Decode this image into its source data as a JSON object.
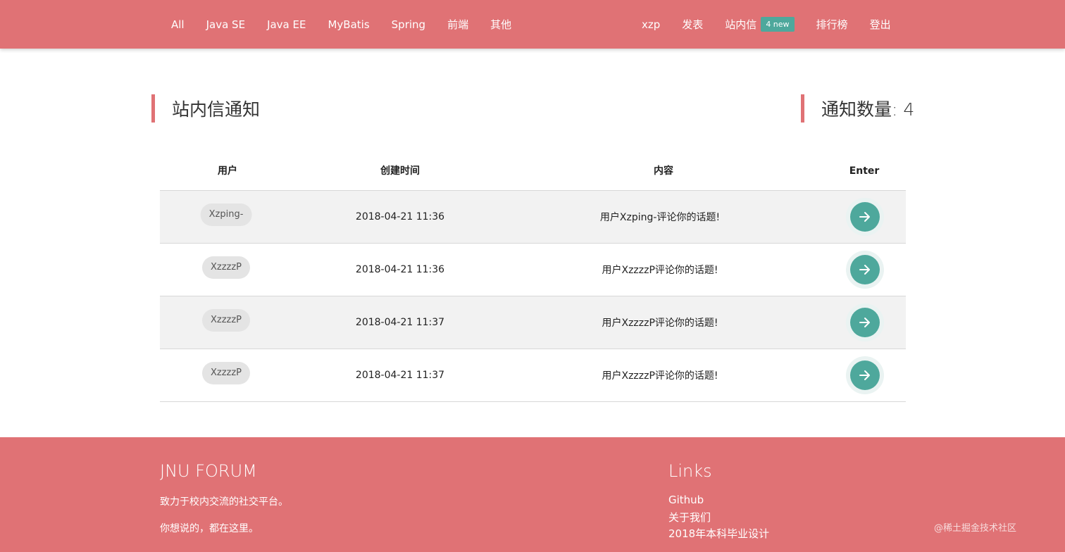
{
  "nav": {
    "left": [
      "All",
      "Java SE",
      "Java EE",
      "MyBatis",
      "Spring",
      "前端",
      "其他"
    ],
    "user": "xzp",
    "post": "发表",
    "messages": "站内信",
    "badge": "4 new",
    "ranking": "排行榜",
    "logout": "登出"
  },
  "page": {
    "title": "站内信通知",
    "count_label": "通知数量: 4"
  },
  "table": {
    "headers": [
      "用户",
      "创建时间",
      "内容",
      "Enter"
    ],
    "rows": [
      {
        "user": "Xzping-",
        "time": "2018-04-21 11:36",
        "content": "用户Xzping-评论你的话题!"
      },
      {
        "user": "XzzzzP",
        "time": "2018-04-21 11:36",
        "content": "用户XzzzzP评论你的话题!"
      },
      {
        "user": "XzzzzP",
        "time": "2018-04-21 11:37",
        "content": "用户XzzzzP评论你的话题!"
      },
      {
        "user": "XzzzzP",
        "time": "2018-04-21 11:37",
        "content": "用户XzzzzP评论你的话题!"
      }
    ]
  },
  "footer": {
    "brand": "JNU FORUM",
    "line1": "致力于校内交流的社交平台。",
    "line2": "你想说的，都在这里。",
    "links_title": "Links",
    "links": [
      "Github",
      "关于我们",
      "2018年本科毕业设计"
    ],
    "watermark": "@稀土掘金技术社区"
  },
  "colors": {
    "brand": "#e07275",
    "accent": "#4ea89c"
  },
  "icons": {
    "enter": "arrow-right-icon"
  }
}
